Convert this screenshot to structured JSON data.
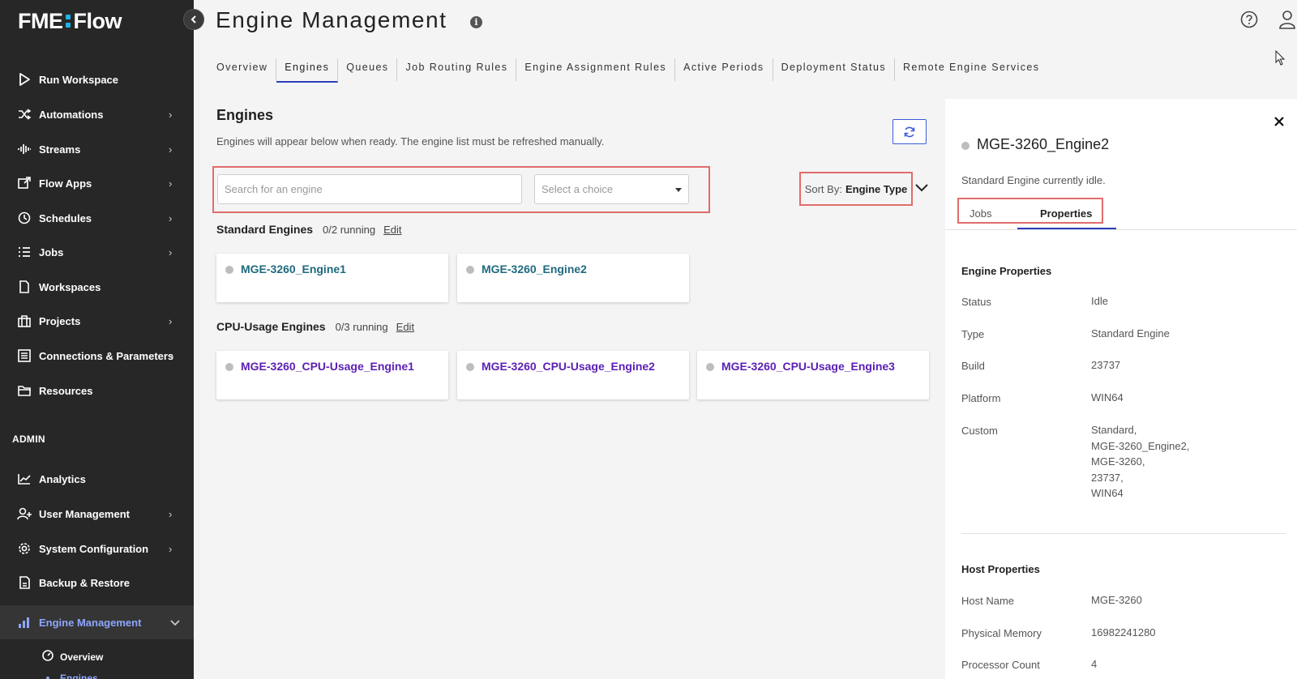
{
  "app": {
    "logo_text_left": "FME",
    "logo_text_right": "Flow",
    "accent_color": "#2a3fb8",
    "logo_accent_color": "#1fb3e8"
  },
  "sidebar": {
    "items": [
      {
        "label": "Run Workspace",
        "icon": "play-icon"
      },
      {
        "label": "Automations",
        "icon": "automations-icon"
      },
      {
        "label": "Streams",
        "icon": "streams-icon"
      },
      {
        "label": "Flow Apps",
        "icon": "flow-apps-icon"
      },
      {
        "label": "Schedules",
        "icon": "clock-icon"
      },
      {
        "label": "Jobs",
        "icon": "jobs-list-icon"
      },
      {
        "label": "Workspaces",
        "icon": "document-icon"
      },
      {
        "label": "Projects",
        "icon": "briefcase-icon"
      },
      {
        "label": "Connections & Parameters",
        "icon": "connections-icon"
      },
      {
        "label": "Resources",
        "icon": "folder-icon"
      }
    ],
    "admin_heading": "ADMIN",
    "admin_items": [
      {
        "label": "Analytics",
        "icon": "chart-icon"
      },
      {
        "label": "User Management",
        "icon": "user-add-icon"
      },
      {
        "label": "System Configuration",
        "icon": "gear-icon"
      },
      {
        "label": "Backup & Restore",
        "icon": "backup-icon"
      },
      {
        "label": "Engine Management",
        "icon": "engine-icon"
      }
    ],
    "sub_items": [
      {
        "label": "Overview",
        "icon": "dashboard-icon"
      },
      {
        "label": "Engines"
      }
    ]
  },
  "header": {
    "title": "Engine Management"
  },
  "tabs": [
    {
      "label": "Overview"
    },
    {
      "label": "Engines"
    },
    {
      "label": "Queues"
    },
    {
      "label": "Job Routing Rules"
    },
    {
      "label": "Engine Assignment Rules"
    },
    {
      "label": "Active Periods"
    },
    {
      "label": "Deployment Status"
    },
    {
      "label": "Remote Engine Services"
    }
  ],
  "main": {
    "heading": "Engines",
    "description": "Engines will appear below when ready. The engine list must be refreshed manually.",
    "search_placeholder": "Search for an engine",
    "select_placeholder": "Select a choice",
    "sort_label": "Sort By:",
    "sort_value": "Engine Type",
    "groups": [
      {
        "title": "Standard Engines",
        "count": "0/2 running",
        "edit": "Edit",
        "engines": [
          "MGE-3260_Engine1",
          "MGE-3260_Engine2"
        ]
      },
      {
        "title": "CPU-Usage Engines",
        "count": "0/3 running",
        "edit": "Edit",
        "engines": [
          "MGE-3260_CPU-Usage_Engine1",
          "MGE-3260_CPU-Usage_Engine2",
          "MGE-3260_CPU-Usage_Engine3"
        ]
      }
    ]
  },
  "detail": {
    "name": "MGE-3260_Engine2",
    "status_text": "Standard Engine currently idle.",
    "tabs": {
      "jobs": "Jobs",
      "properties": "Properties"
    },
    "engine_properties_title": "Engine Properties",
    "engine_properties": [
      {
        "label": "Status",
        "value": "Idle"
      },
      {
        "label": "Type",
        "value": "Standard Engine"
      },
      {
        "label": "Build",
        "value": "23737"
      },
      {
        "label": "Platform",
        "value": "WIN64"
      },
      {
        "label": "Custom",
        "lines": [
          "Standard,",
          "MGE-3260_Engine2,",
          "MGE-3260,",
          "23737,",
          "WIN64"
        ]
      }
    ],
    "host_properties_title": "Host Properties",
    "host_properties": [
      {
        "label": "Host Name",
        "value": "MGE-3260"
      },
      {
        "label": "Physical Memory",
        "value": "16982241280"
      },
      {
        "label": "Processor Count",
        "value": "4"
      }
    ]
  }
}
